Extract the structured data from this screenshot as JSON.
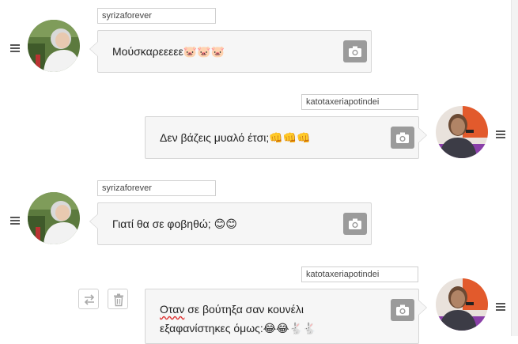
{
  "messages": [
    {
      "username": "syrizaforever",
      "text": "Μούσκαρεεεεε",
      "emojis": "🐷🐷🐷",
      "side": "left"
    },
    {
      "username": "katotaxeriapotindei",
      "text": "Δεν βάζεις μυαλό έτσι;",
      "emojis": "👊👊👊",
      "side": "right"
    },
    {
      "username": "syrizaforever",
      "text": "Γιατί θα σε φοβηθώ; ",
      "emojis": "😊😊",
      "side": "left"
    },
    {
      "username": "katotaxeriapotindei",
      "line1_word1": "Οταν",
      "line1_rest": " σε βούτηξα σαν κουνέλι",
      "line2_text": "εξαφανίστηκες όμως:",
      "emojis": "😂😂🐇🐇",
      "side": "right"
    }
  ],
  "icons": {
    "camera": "camera-icon",
    "menu": "hamburger-menu-icon",
    "swap": "swap-arrows-icon",
    "delete": "trash-icon"
  },
  "colors": {
    "bubble_bg": "#f6f6f6",
    "bubble_border": "#d6d6d6",
    "camera_button": "#9b9b9b"
  }
}
